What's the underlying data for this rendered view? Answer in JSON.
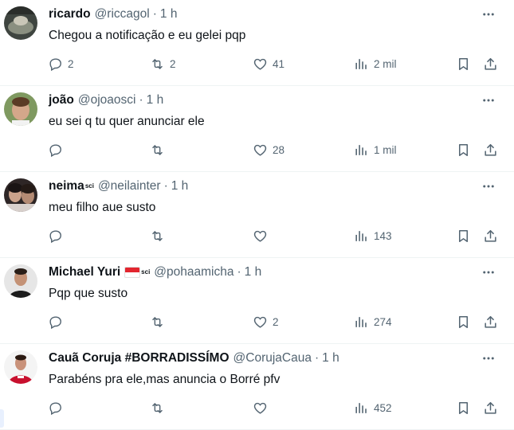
{
  "tweets": [
    {
      "name": "ricardo",
      "handle": "@riccagol",
      "time": "1 h",
      "text": "Chegou a notificação e eu gelei pqp",
      "replies": "2",
      "retweets": "2",
      "likes": "41",
      "views": "2 mil",
      "avatar_color": "#4a4f4a"
    },
    {
      "name": "joão",
      "handle": "@ojoaosci",
      "time": "1 h",
      "text": "eu sei q tu quer anunciar ele",
      "replies": "",
      "retweets": "",
      "likes": "28",
      "views": "1 mil",
      "avatar_color": "#6e8a55"
    },
    {
      "name": "neima",
      "name_badge": "sci",
      "handle": "@neilainter",
      "time": "1 h",
      "text": "meu filho aue susto",
      "replies": "",
      "retweets": "",
      "likes": "",
      "views": "143",
      "avatar_color": "#3b3030"
    },
    {
      "name": "Michael Yuri",
      "name_badge": "sci",
      "handle": "@pohaamicha",
      "time": "1 h",
      "text": "Pqp que susto",
      "replies": "",
      "retweets": "",
      "likes": "2",
      "views": "274",
      "avatar_color": "#d9d9d9"
    },
    {
      "name": "Cauã Coruja #BORRADISSÍMO",
      "handle": "@CorujaCaua",
      "time": "1 h",
      "text": "Parabéns pra ele,mas anuncia o Borré pfv",
      "replies": "",
      "retweets": "",
      "likes": "",
      "views": "452",
      "avatar_color": "#c8102e"
    }
  ],
  "separator": "·",
  "icons": {
    "reply": "reply-icon",
    "retweet": "retweet-icon",
    "like": "heart-icon",
    "views": "views-icon",
    "bookmark": "bookmark-icon",
    "share": "share-icon",
    "more": "more-icon"
  },
  "colors": {
    "text": "#0f1419",
    "secondary": "#536471",
    "divider": "#eff3f4"
  }
}
